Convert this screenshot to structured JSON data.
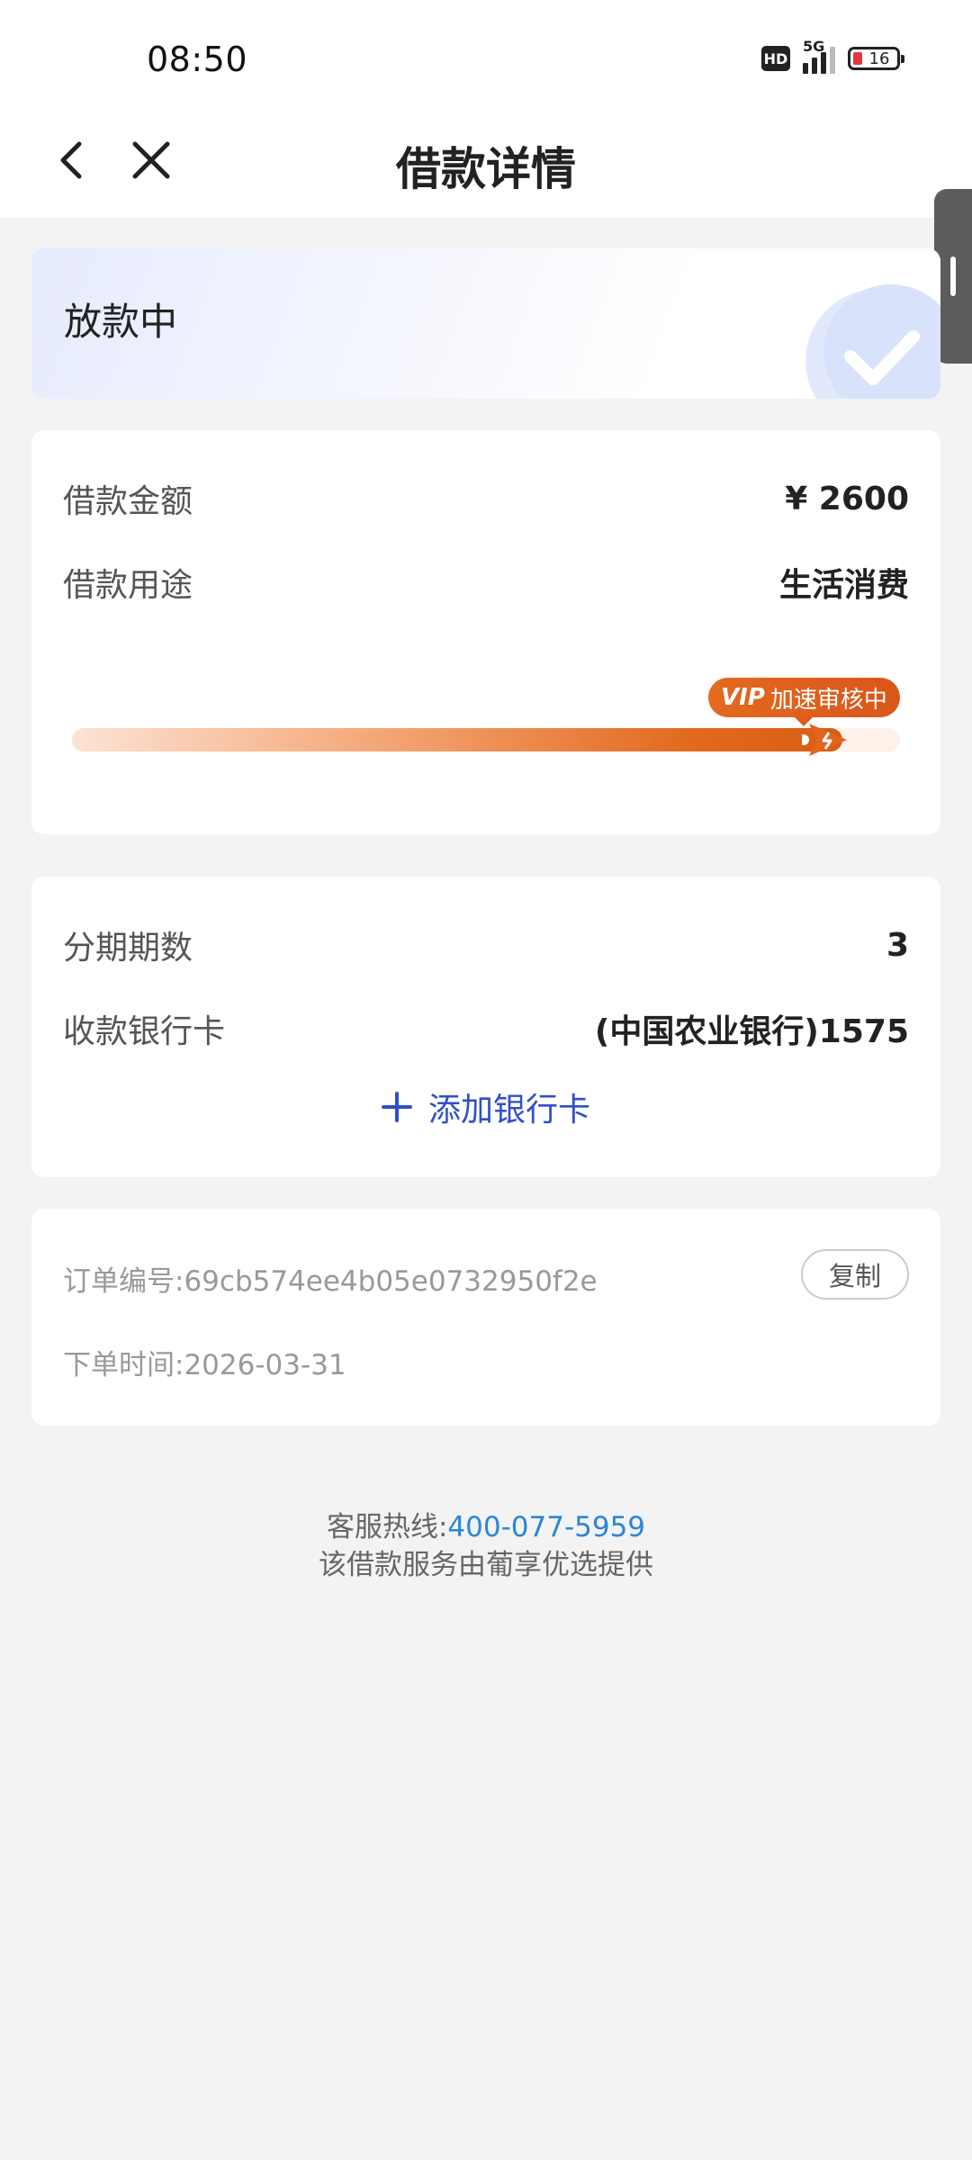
{
  "status_bar": {
    "time": "08:50",
    "hd": "HD",
    "network": "5G",
    "battery": "16"
  },
  "nav": {
    "title": "借款详情"
  },
  "status": {
    "text": "放款中"
  },
  "loan": {
    "amount_label": "借款金额",
    "amount_value": "¥ 2600",
    "purpose_label": "借款用途",
    "purpose_value": "生活消费",
    "progress_fraction": 0.93,
    "vip_tag": "VIP",
    "vip_text": "加速审核中"
  },
  "repayment": {
    "installments_label": "分期期数",
    "installments_value": "3",
    "bank_label": "收款银行卡",
    "bank_value": "(中国农业银行)1575",
    "add_card": "添加银行卡"
  },
  "order": {
    "number_label": "订单编号:",
    "number_value": "69cb574ee4b05e0732950f2e",
    "copy": "复制",
    "time_label": "下单时间:",
    "time_value": "2026-03-31"
  },
  "footer": {
    "hotline_label": "客服热线:",
    "hotline_number": "400-077-5959",
    "provider": "该借款服务由葡享优选提供"
  },
  "colors": {
    "accent_orange": "#d95c12",
    "link_blue": "#2f4fc9",
    "hotline_blue": "#2a86d8"
  }
}
